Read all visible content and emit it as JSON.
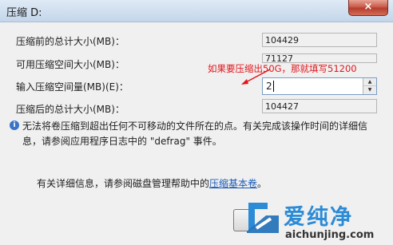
{
  "window": {
    "title": "压缩 D:",
    "close_glyph": "×"
  },
  "fields": [
    {
      "label": "压缩前的总计大小(MB)：",
      "value": "104429"
    },
    {
      "label": "可用压缩空间大小(MB)：",
      "value": "71127"
    },
    {
      "label": "输入压缩空间量(MB)(E)：",
      "value": "2"
    },
    {
      "label": "压缩后的总计大小(MB)：",
      "value": "104427"
    }
  ],
  "annotation": "如果要压缩出50G，那就填写51200",
  "info": {
    "icon": "info-icon",
    "text": "无法将卷压缩到超出任何不可移动的文件所在的点。有关完成该操作时间的详细信息，请参阅应用程序日志中的 \"defrag\" 事件。"
  },
  "help": {
    "prefix": "有关详细信息，请参阅磁盘管理帮助中的",
    "link": "压缩基本卷",
    "suffix": "。"
  },
  "watermark": {
    "brand": "爱纯净",
    "url": "aichunjing.com"
  },
  "colors": {
    "annotation": "#e0161c",
    "link": "#1a5bb8",
    "watermark": "#2c8bd6"
  }
}
